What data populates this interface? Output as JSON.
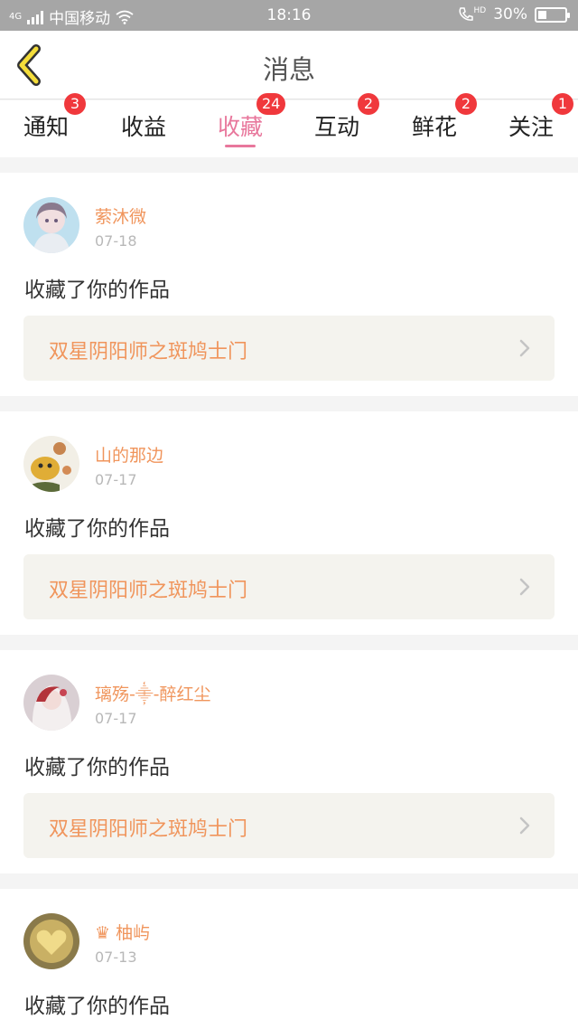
{
  "status": {
    "carrier": "中国移动",
    "time": "18:16",
    "battery": "30%",
    "network": "4G",
    "call": "HD"
  },
  "header": {
    "title": "消息"
  },
  "tabs": [
    {
      "label": "通知",
      "badge": "3"
    },
    {
      "label": "收益",
      "badge": ""
    },
    {
      "label": "收藏",
      "badge": "24",
      "active": true
    },
    {
      "label": "互动",
      "badge": "2"
    },
    {
      "label": "鲜花",
      "badge": "2"
    },
    {
      "label": "关注",
      "badge": "1"
    }
  ],
  "items": [
    {
      "name": "萦沐微",
      "date": "07-18",
      "action": "收藏了你的作品",
      "work": "双星阴阳师之斑鸠士门"
    },
    {
      "name": "山的那边",
      "date": "07-17",
      "action": "收藏了你的作品",
      "work": "双星阴阳师之斑鸠士门"
    },
    {
      "name": "璃殇-⸎-醉红尘",
      "date": "07-17",
      "action": "收藏了你的作品",
      "work": "双星阴阳师之斑鸠士门"
    },
    {
      "name": "♛ 柚屿",
      "date": "07-13",
      "action": "收藏了你的作品",
      "work": ""
    }
  ],
  "colors": {
    "accent": "#e8779c",
    "highlight": "#f0955c",
    "badge": "#f0383c"
  }
}
